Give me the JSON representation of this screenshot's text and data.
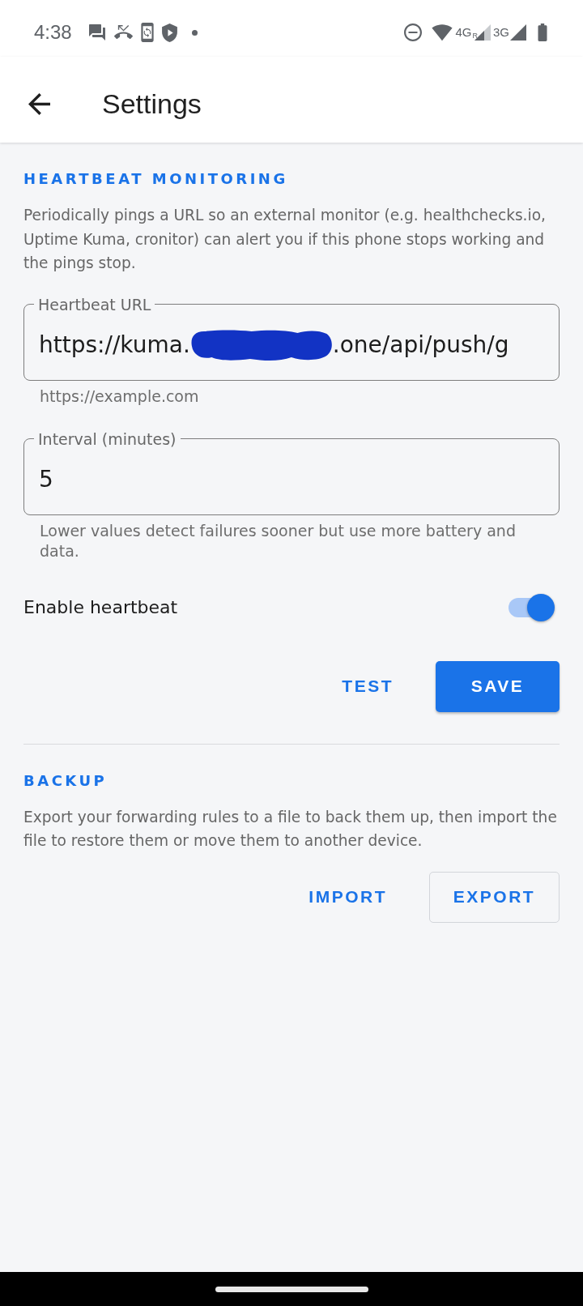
{
  "status_bar": {
    "time": "4:38",
    "signals": [
      {
        "network": "4G",
        "roaming": "R"
      },
      {
        "network": "3G"
      }
    ]
  },
  "app_bar": {
    "title": "Settings"
  },
  "sections": [
    {
      "heading": "HEARTBEAT MONITORING",
      "description": "Periodically pings a URL so an external monitor (e.g. healthchecks.io, Uptime Kuma, cronitor) can alert you if this phone stops working and the pings stop.",
      "fields": [
        {
          "label": "Heartbeat URL",
          "segments": [
            {
              "kind": "text",
              "text": "https://kuma."
            },
            {
              "kind": "redacted"
            },
            {
              "kind": "text",
              "text": ".one/api/push/g"
            }
          ],
          "helper": "https://example.com"
        },
        {
          "label": "Interval (minutes)",
          "segments": [
            {
              "kind": "text",
              "text": "5"
            }
          ],
          "helper": "Lower values detect failures sooner but use more battery and data."
        }
      ],
      "toggle": {
        "label": "Enable heartbeat",
        "on": true
      },
      "buttons": [
        {
          "label": "TEST",
          "kind": "text"
        },
        {
          "label": "SAVE",
          "kind": "filled"
        }
      ]
    },
    {
      "heading": "BACKUP",
      "description": "Export your forwarding rules to a file to back them up, then import the file to restore them or move them to another device.",
      "buttons": [
        {
          "label": "IMPORT",
          "kind": "text"
        },
        {
          "label": "EXPORT",
          "kind": "outlined"
        }
      ]
    }
  ]
}
